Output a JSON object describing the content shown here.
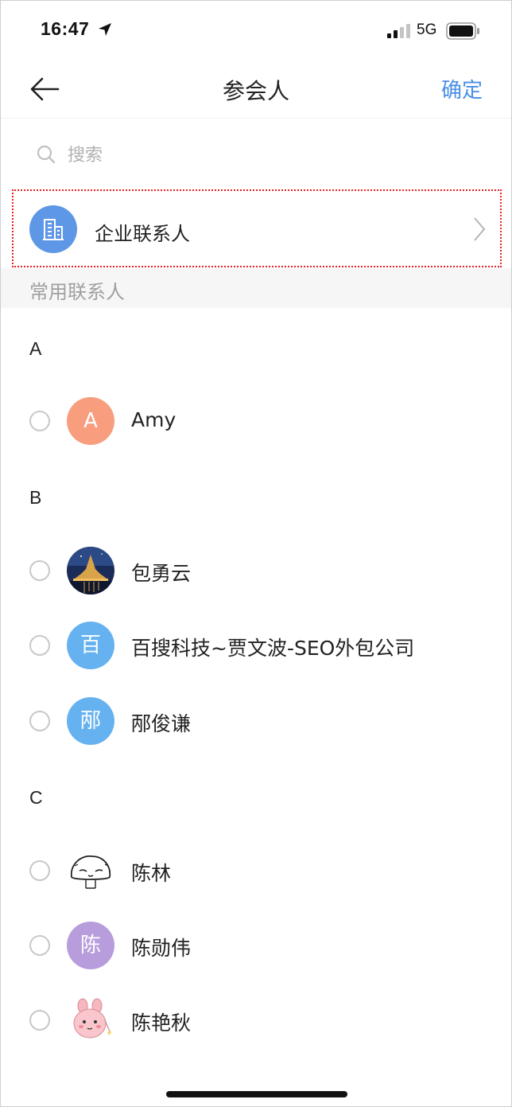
{
  "status_bar": {
    "time": "16:47",
    "network": "5G"
  },
  "nav": {
    "title": "参会人",
    "confirm_label": "确定"
  },
  "search": {
    "placeholder": "搜索"
  },
  "enterprise": {
    "label": "企业联系人",
    "avatar_color": "#5e97e6"
  },
  "section_title": "常用联系人",
  "groups": [
    {
      "letter": "A",
      "contacts": [
        {
          "name": "Amy",
          "avatar_text": "A",
          "avatar_color": "#f89e7e"
        }
      ]
    },
    {
      "letter": "B",
      "contacts": [
        {
          "name": "包勇云",
          "avatar_text": "",
          "avatar_kind": "photo-night-castle"
        },
        {
          "name": "百搜科技~贾文波-SEO外包公司",
          "avatar_text": "百",
          "avatar_color": "#66b2f0"
        },
        {
          "name": "邴俊谦",
          "avatar_text": "邴",
          "avatar_color": "#66b2f0"
        }
      ]
    },
    {
      "letter": "C",
      "contacts": [
        {
          "name": "陈林",
          "avatar_text": "",
          "avatar_kind": "sketch-face"
        },
        {
          "name": "陈勋伟",
          "avatar_text": "陈",
          "avatar_color": "#b79ddc"
        },
        {
          "name": "陈艳秋",
          "avatar_text": "",
          "avatar_kind": "pink-bunny"
        }
      ]
    }
  ],
  "colors": {
    "accent": "#4a8ee6",
    "highlight_border": "#e62020"
  }
}
